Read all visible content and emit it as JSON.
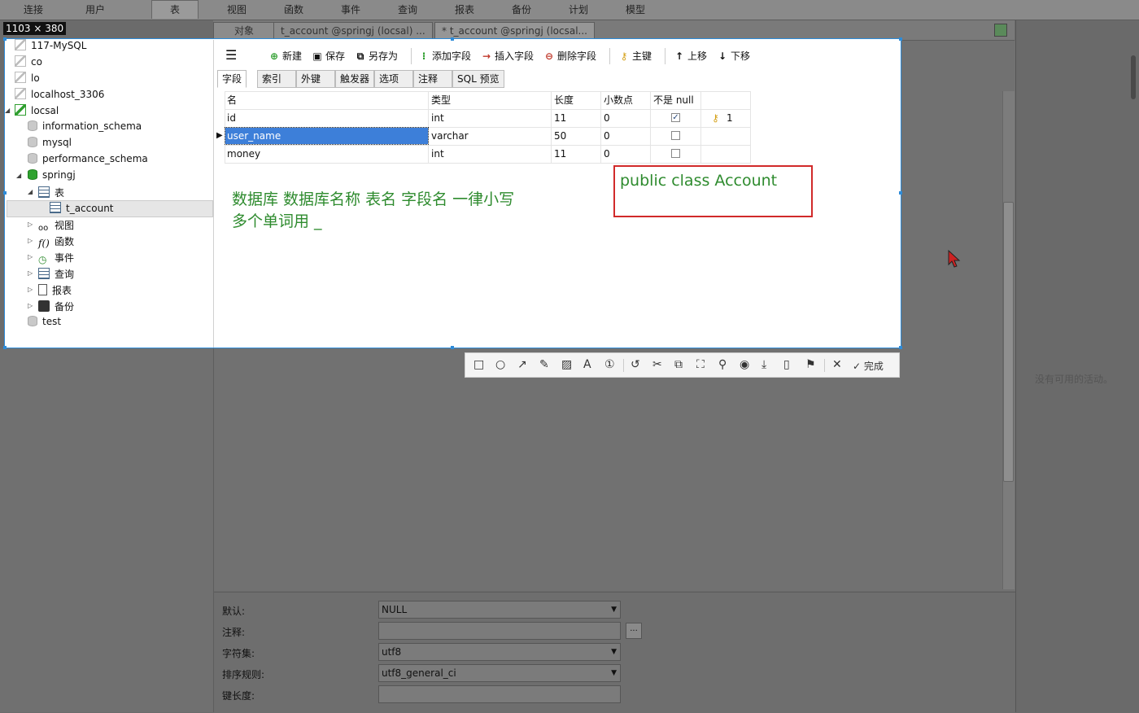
{
  "menu": [
    "连接",
    "用户",
    "表",
    "视图",
    "函数",
    "事件",
    "查询",
    "报表",
    "备份",
    "计划",
    "模型"
  ],
  "object_tabs": [
    "对象",
    "t_account @springj (locsal) ...",
    "* t_account @springj (locsal..."
  ],
  "selection_size": "1103 × 380",
  "tree": {
    "connections": [
      "117-MySQL",
      "co",
      "lo",
      "localhost_3306",
      "locsal"
    ],
    "databases": [
      "information_schema",
      "mysql",
      "performance_schema",
      "springj"
    ],
    "springj_children": [
      "表",
      "视图",
      "函数",
      "事件",
      "查询",
      "报表",
      "备份"
    ],
    "table_item": "t_account",
    "last_db": "test"
  },
  "toolbar": {
    "new": "新建",
    "save": "保存",
    "save_as": "另存为",
    "add_field": "添加字段",
    "insert_field": "插入字段",
    "delete_field": "删除字段",
    "primary_key": "主键",
    "move_up": "上移",
    "move_down": "下移"
  },
  "sub_tabs": [
    "字段",
    "索引",
    "外键",
    "触发器",
    "选项",
    "注释",
    "SQL 预览"
  ],
  "grid": {
    "headers": [
      "名",
      "类型",
      "长度",
      "小数点",
      "不是 null"
    ],
    "rows": [
      {
        "name": "id",
        "type": "int",
        "length": "11",
        "decimals": "0",
        "not_null": true,
        "key": "1"
      },
      {
        "name": "user_name",
        "type": "varchar",
        "length": "50",
        "decimals": "0",
        "not_null": false,
        "key": ""
      },
      {
        "name": "money",
        "type": "int",
        "length": "11",
        "decimals": "0",
        "not_null": false,
        "key": ""
      }
    ]
  },
  "annotations": {
    "line1": "数据库 数据库名称  表名  字段名  一律小写",
    "line2": "多个单词用  _",
    "box": "public class Account"
  },
  "screenshot_toolbar": {
    "done": "完成"
  },
  "props": {
    "default_label": "默认:",
    "default_value": "NULL",
    "comment_label": "注释:",
    "comment_btn": "...",
    "charset_label": "字符集:",
    "charset_value": "utf8",
    "collation_label": "排序规则:",
    "collation_value": "utf8_general_ci",
    "keylen_label": "键长度:"
  },
  "right_panel": {
    "no_activity": "没有可用的活动。"
  },
  "colors": {
    "selection": "#2d8bd8",
    "annotation_green": "#2e8b2e",
    "annotation_red": "#d12a2a",
    "row_highlight": "#3d7fd9"
  }
}
